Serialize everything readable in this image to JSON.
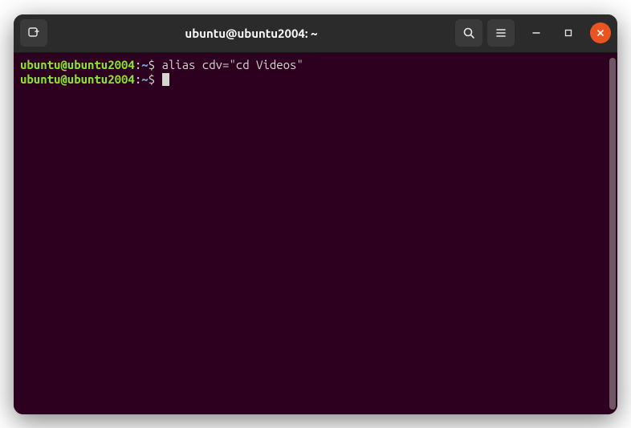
{
  "window": {
    "title": "ubuntu@ubuntu2004: ~"
  },
  "prompt": {
    "user_host": "ubuntu@ubuntu2004",
    "colon": ":",
    "path": "~",
    "dollar": "$ "
  },
  "terminal": {
    "lines": [
      {
        "command": "alias cdv=\"cd Videos\""
      },
      {
        "command": ""
      }
    ]
  }
}
